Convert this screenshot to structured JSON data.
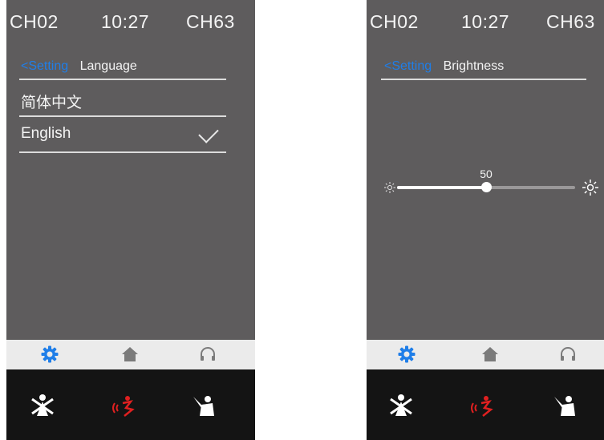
{
  "left_phone": {
    "status": {
      "left_channel": "CH02",
      "time": "10:27",
      "right_channel": "CH63"
    },
    "header": {
      "back_label": "<Setting",
      "title": "Language"
    },
    "languages": [
      {
        "label": "简体中文",
        "selected": false
      },
      {
        "label": "English",
        "selected": true
      }
    ]
  },
  "right_phone": {
    "status": {
      "left_channel": "CH02",
      "time": "10:27",
      "right_channel": "CH63"
    },
    "header": {
      "back_label": "<Setting",
      "title": "Brightness"
    },
    "brightness": {
      "value": "50",
      "fraction": 0.5
    }
  },
  "tabbar": {
    "icons": [
      "gear-icon",
      "home-icon",
      "headphones-icon"
    ]
  },
  "actionbar": {
    "icons": [
      "mute-person-icon",
      "call-signal-icon",
      "raise-hand-person-icon"
    ]
  },
  "colors": {
    "screen": "#5e5c5d",
    "accent": "#1f7ee8",
    "tabbar": "#ebebeb",
    "actionbar": "#141414",
    "alert": "#e02020"
  }
}
